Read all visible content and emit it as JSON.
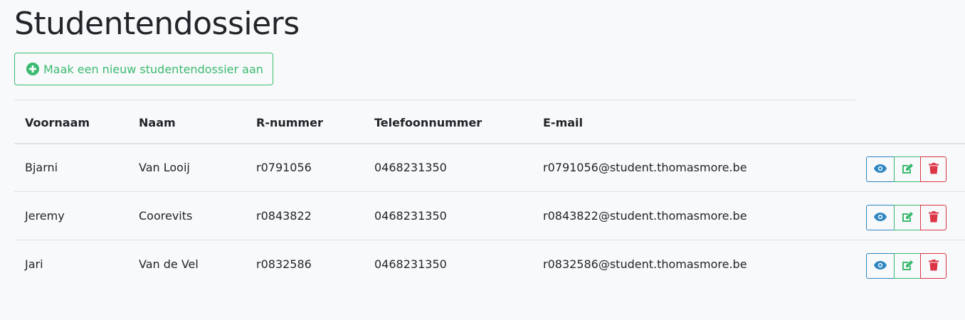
{
  "page": {
    "title": "Studentendossiers"
  },
  "toolbar": {
    "add_label": "Maak een nieuw studentendossier aan"
  },
  "table": {
    "headers": [
      "Voornaam",
      "Naam",
      "R-nummer",
      "Telefoonnummer",
      "E-mail"
    ],
    "rows": [
      [
        "Bjarni",
        "Van Looij",
        "r0791056",
        "0468231350",
        "r0791056@student.thomasmore.be"
      ],
      [
        "Jeremy",
        "Coorevits",
        "r0843822",
        "0468231350",
        "r0843822@student.thomasmore.be"
      ],
      [
        "Jari",
        "Van de Vel",
        "r0832586",
        "0468231350",
        "r0832586@student.thomasmore.be"
      ]
    ]
  },
  "colors": {
    "success": "#3cba70",
    "info": "#2e86c1",
    "danger": "#dc3545"
  },
  "icons": {
    "add": "plus-circle-icon",
    "view": "eye-icon",
    "edit": "edit-icon",
    "delete": "trash-icon"
  }
}
